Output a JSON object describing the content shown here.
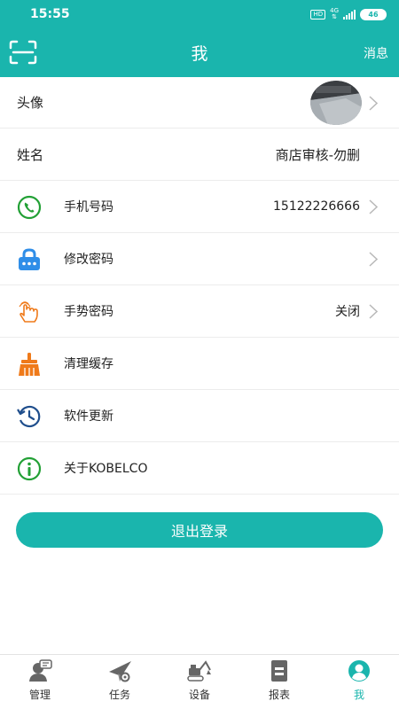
{
  "status_bar": {
    "time": "15:55",
    "hd": "HD",
    "network": "4G",
    "battery": "46"
  },
  "header": {
    "title": "我",
    "messages_label": "消息"
  },
  "rows": {
    "avatar": {
      "label": "头像"
    },
    "name": {
      "label": "姓名",
      "value": "商店审核-勿删"
    },
    "phone": {
      "label": "手机号码",
      "value": "15122226666"
    },
    "password": {
      "label": "修改密码"
    },
    "gesture": {
      "label": "手势密码",
      "value": "关闭"
    },
    "cache": {
      "label": "清理缓存"
    },
    "update": {
      "label": "软件更新"
    },
    "about": {
      "label": "关于KOBELCO"
    }
  },
  "logout_label": "退出登录",
  "tabs": [
    {
      "label": "管理",
      "icon": "manage-icon"
    },
    {
      "label": "任务",
      "icon": "task-icon"
    },
    {
      "label": "设备",
      "icon": "excavator-icon"
    },
    {
      "label": "报表",
      "icon": "report-icon"
    },
    {
      "label": "我",
      "icon": "profile-icon",
      "active": true
    }
  ],
  "colors": {
    "accent": "#1ab5ad",
    "phone": "#22a035",
    "lock": "#2f8ee8",
    "gesture": "#ef7a1a",
    "broom": "#ef7a1a",
    "update": "#1f4e8c",
    "about": "#22a035"
  }
}
